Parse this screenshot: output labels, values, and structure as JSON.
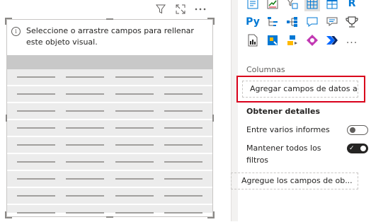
{
  "visual": {
    "header_icons": [
      "filter-icon",
      "focus-mode-icon",
      "more-options-icon"
    ],
    "placeholder_message": "Seleccione o arrastre campos para rellenar este objeto visual.",
    "table_placeholder_rows": 9,
    "table_placeholder_columns": 4
  },
  "visualizations": {
    "icons": [
      "matrix-icon",
      "kpi-icon",
      "slicer-icon",
      "table-icon",
      "matrix-table-icon",
      "r-script-visual-icon",
      "python-visual-icon",
      "key-influencers-icon",
      "decomposition-tree-icon",
      "qa-icon",
      "smart-narrative-icon",
      "goals-icon",
      "paginated-report-icon",
      "power-apps-icon",
      "power-automate-icon",
      "azure-map-icon",
      "power-automate-flow-icon",
      "more-visuals-icon"
    ],
    "r_label": "R",
    "py_label": "Py",
    "more_label": "..."
  },
  "fields": {
    "columns_label": "Columnas",
    "columns_placeholder": "Agregar campos de datos a...",
    "drillthrough_title": "Obtener detalles",
    "cross_report_label": "Entre varios informes",
    "cross_report_on": false,
    "keep_filters_label": "Mantener todos los filtros",
    "keep_filters_on": true,
    "drillthrough_placeholder": "Agregue los campos de ob...",
    "highlight_color": "#d9001b"
  }
}
